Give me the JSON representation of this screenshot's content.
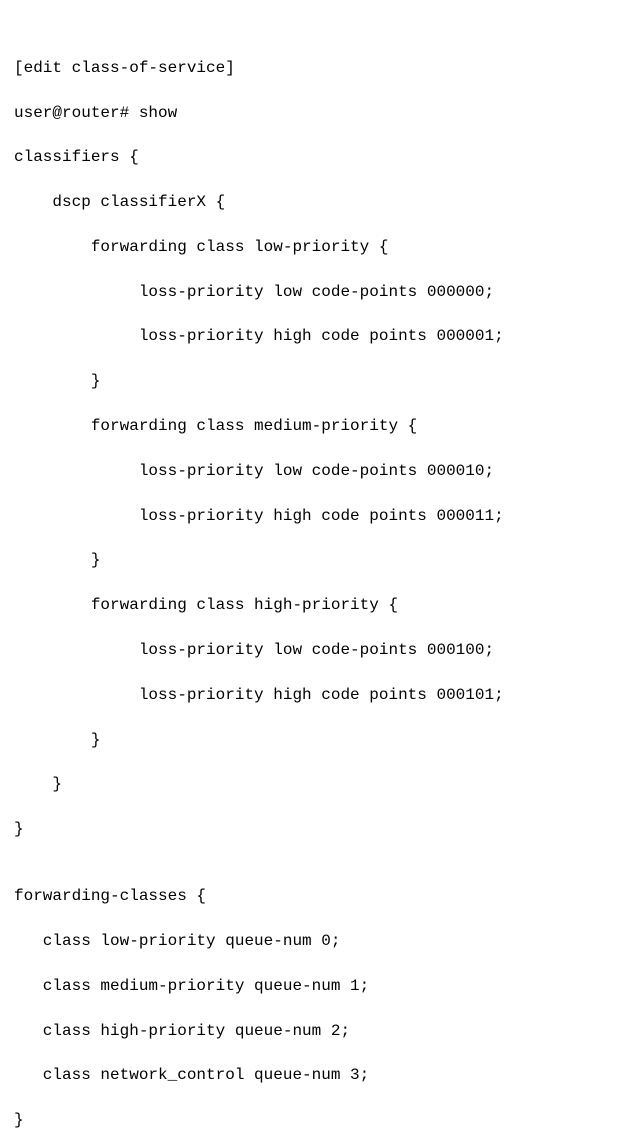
{
  "context_line": "[edit class-of-service]",
  "prompt": "user@router# show",
  "classifiers": {
    "open": "classifiers {",
    "dscp_open": "    dscp classifierX {",
    "fc_low": {
      "open": "        forwarding class low-priority {",
      "l1": "             loss-priority low code-points 000000;",
      "l2": "             loss-priority high code points 000001;",
      "close": "        }"
    },
    "fc_med": {
      "open": "        forwarding class medium-priority {",
      "l1": "             loss-priority low code-points 000010;",
      "l2": "             loss-priority high code points 000011;",
      "close": "        }"
    },
    "fc_high": {
      "open": "        forwarding class high-priority {",
      "l1": "             loss-priority low code-points 000100;",
      "l2": "             loss-priority high code points 000101;",
      "close": "        }"
    },
    "dscp_close": "    }",
    "close": "}"
  },
  "blank": "",
  "fwd_classes": {
    "open": "forwarding-classes {",
    "c0": "   class low-priority queue-num 0;",
    "c1": "   class medium-priority queue-num 1;",
    "c2": "   class high-priority queue-num 2;",
    "c3": "   class network_control queue-num 3;",
    "close": "}"
  }
}
